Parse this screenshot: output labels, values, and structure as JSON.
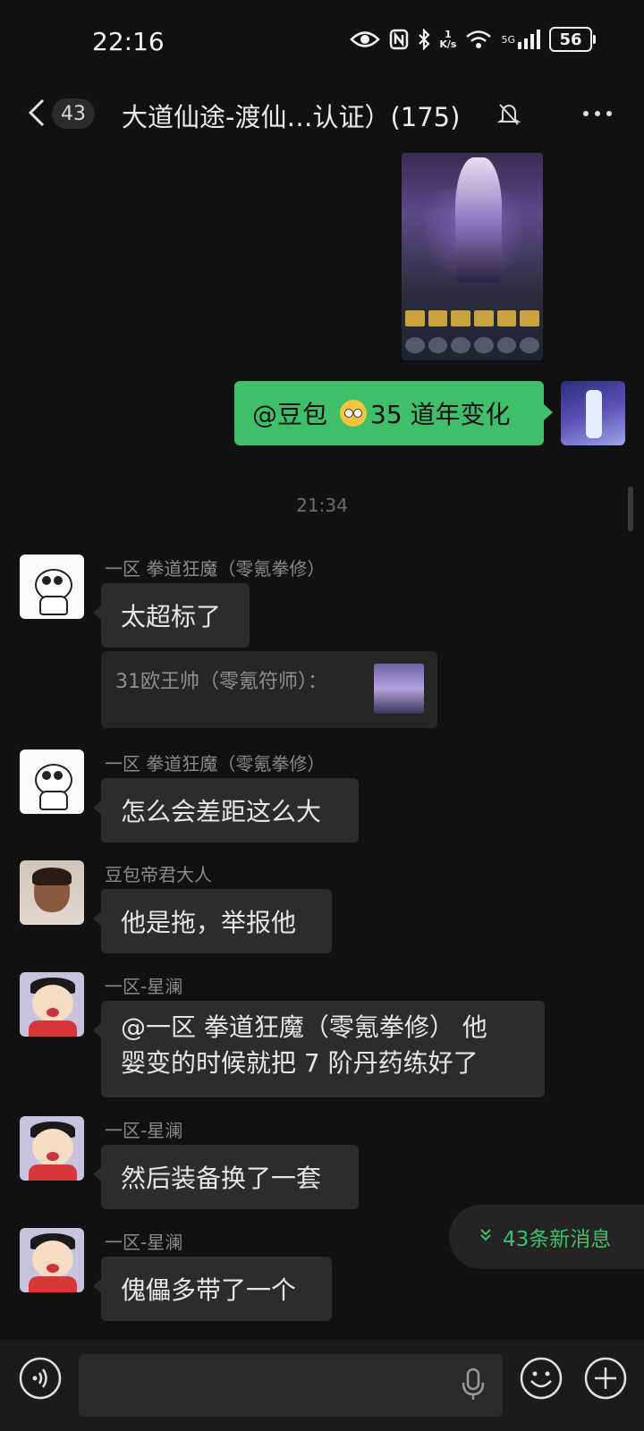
{
  "status_bar": {
    "time": "22:16",
    "net_speed_value": "1",
    "net_speed_unit": "K/s",
    "network": "5G",
    "battery": "56"
  },
  "header": {
    "unread_count": "43",
    "title": "大道仙途-渡仙…认证）(175)",
    "icons": [
      "back-icon",
      "mute-bell-icon",
      "more-icon"
    ]
  },
  "messages_top": {
    "self_text_prefix": "@豆包",
    "self_text_suffix": "35 道年变化"
  },
  "timestamp": "21:34",
  "messages": [
    {
      "sender": "一区  拳道狂魔（零氪拳修）",
      "text": "太超标了"
    },
    {
      "quote": "31欧王帅（零氪符师）："
    },
    {
      "sender": "一区  拳道狂魔（零氪拳修）",
      "text": "怎么会差距这么大"
    },
    {
      "sender": "豆包帝君大人",
      "text": "他是拖，举报他"
    },
    {
      "sender": "一区-星澜",
      "text_line1": "@一区  拳道狂魔（零氪拳修）  他",
      "text_line2": "婴变的时候就把 7 阶丹药练好了"
    },
    {
      "sender": "一区-星澜",
      "text": "然后装备换了一套"
    },
    {
      "sender": "一区-星澜",
      "text": "傀儡多带了一个"
    }
  ],
  "new_messages": "43条新消息",
  "input": {
    "value": "",
    "placeholder": ""
  },
  "colors": {
    "accent": "#3fbf6a",
    "background": "#111111",
    "bubble": "#2c2c2c"
  }
}
